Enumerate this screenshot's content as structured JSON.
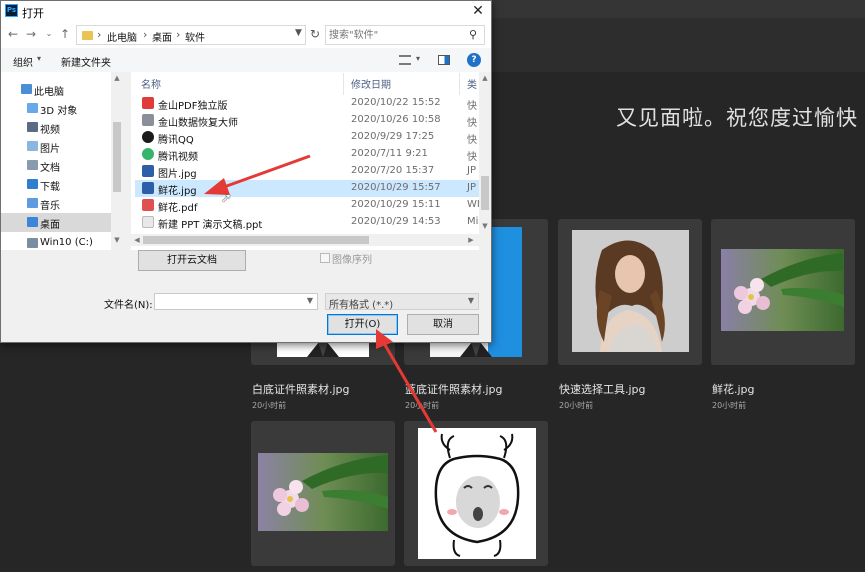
{
  "photoshop": {
    "greeting": "又见面啦。祝您度过愉快",
    "recent_files": [
      {
        "name": "白底证件照素材.jpg",
        "time": "20小时前"
      },
      {
        "name": "蓝底证件照素材.jpg",
        "time": "20小时前"
      },
      {
        "name": "快速选择工具.jpg",
        "time": "20小时前"
      },
      {
        "name": "鲜花.jpg",
        "time": "20小时前"
      },
      {
        "name": "",
        "time": ""
      },
      {
        "name": "",
        "time": ""
      }
    ]
  },
  "dialog": {
    "title": "打开",
    "breadcrumb": [
      "此电脑",
      "桌面",
      "软件"
    ],
    "search_placeholder": "搜索\"软件\"",
    "toolbar": {
      "organize": "组织",
      "new_folder": "新建文件夹"
    },
    "nav_tree": [
      {
        "label": "此电脑",
        "icon": "computer-icon",
        "color": "#4a8fd6"
      },
      {
        "label": "3D 对象",
        "icon": "3d-objects-icon",
        "color": "#6aa8e8"
      },
      {
        "label": "视频",
        "icon": "video-folder-icon",
        "color": "#5b6b86"
      },
      {
        "label": "图片",
        "icon": "pictures-folder-icon",
        "color": "#8ab7e0"
      },
      {
        "label": "文档",
        "icon": "documents-folder-icon",
        "color": "#8a9bb0"
      },
      {
        "label": "下载",
        "icon": "downloads-folder-icon",
        "color": "#2f7fd0"
      },
      {
        "label": "音乐",
        "icon": "music-folder-icon",
        "color": "#5e9be0"
      },
      {
        "label": "桌面",
        "icon": "desktop-folder-icon",
        "color": "#3a86d8"
      },
      {
        "label": "Win10 (C:)",
        "icon": "drive-icon",
        "color": "#7a8da3"
      }
    ],
    "columns": {
      "name": "名称",
      "modified": "修改日期",
      "type": "类"
    },
    "files": [
      {
        "name": "金山PDF独立版",
        "date": "2020/10/22 15:52",
        "type": "快",
        "icon": "kingsoft-pdf-icon",
        "color": "#e03b3b"
      },
      {
        "name": "金山数据恢复大师",
        "date": "2020/10/26 10:58",
        "type": "快",
        "icon": "data-recovery-icon",
        "color": "#8a8f98"
      },
      {
        "name": "腾讯QQ",
        "date": "2020/9/29 17:25",
        "type": "快",
        "icon": "qq-icon",
        "color": "#1b1b1b"
      },
      {
        "name": "腾讯视频",
        "date": "2020/7/11 9:21",
        "type": "快",
        "icon": "tencent-video-icon",
        "color": "#36b56a"
      },
      {
        "name": "图片.jpg",
        "date": "2020/7/20 15:37",
        "type": "JP",
        "icon": "image-file-icon",
        "color": "#2c5fa8"
      },
      {
        "name": "鲜花.jpg",
        "date": "2020/10/29 15:57",
        "type": "JP",
        "icon": "image-file-icon",
        "color": "#2c5fa8"
      },
      {
        "name": "鲜花.pdf",
        "date": "2020/10/29 15:11",
        "type": "WI",
        "icon": "pdf-file-icon",
        "color": "#e05050"
      },
      {
        "name": "新建 PPT 演示文稿.ppt",
        "date": "2020/10/29 14:53",
        "type": "Mi",
        "icon": "ppt-file-icon",
        "color": "#e8e8e8"
      }
    ],
    "open_cloud_label": "打开云文档",
    "image_sequence_label": "图像序列",
    "filename_label": "文件名(N):",
    "filename_value": "",
    "file_filter": "所有格式 (*.*)",
    "open_label": "打开(O)",
    "cancel_label": "取消"
  }
}
